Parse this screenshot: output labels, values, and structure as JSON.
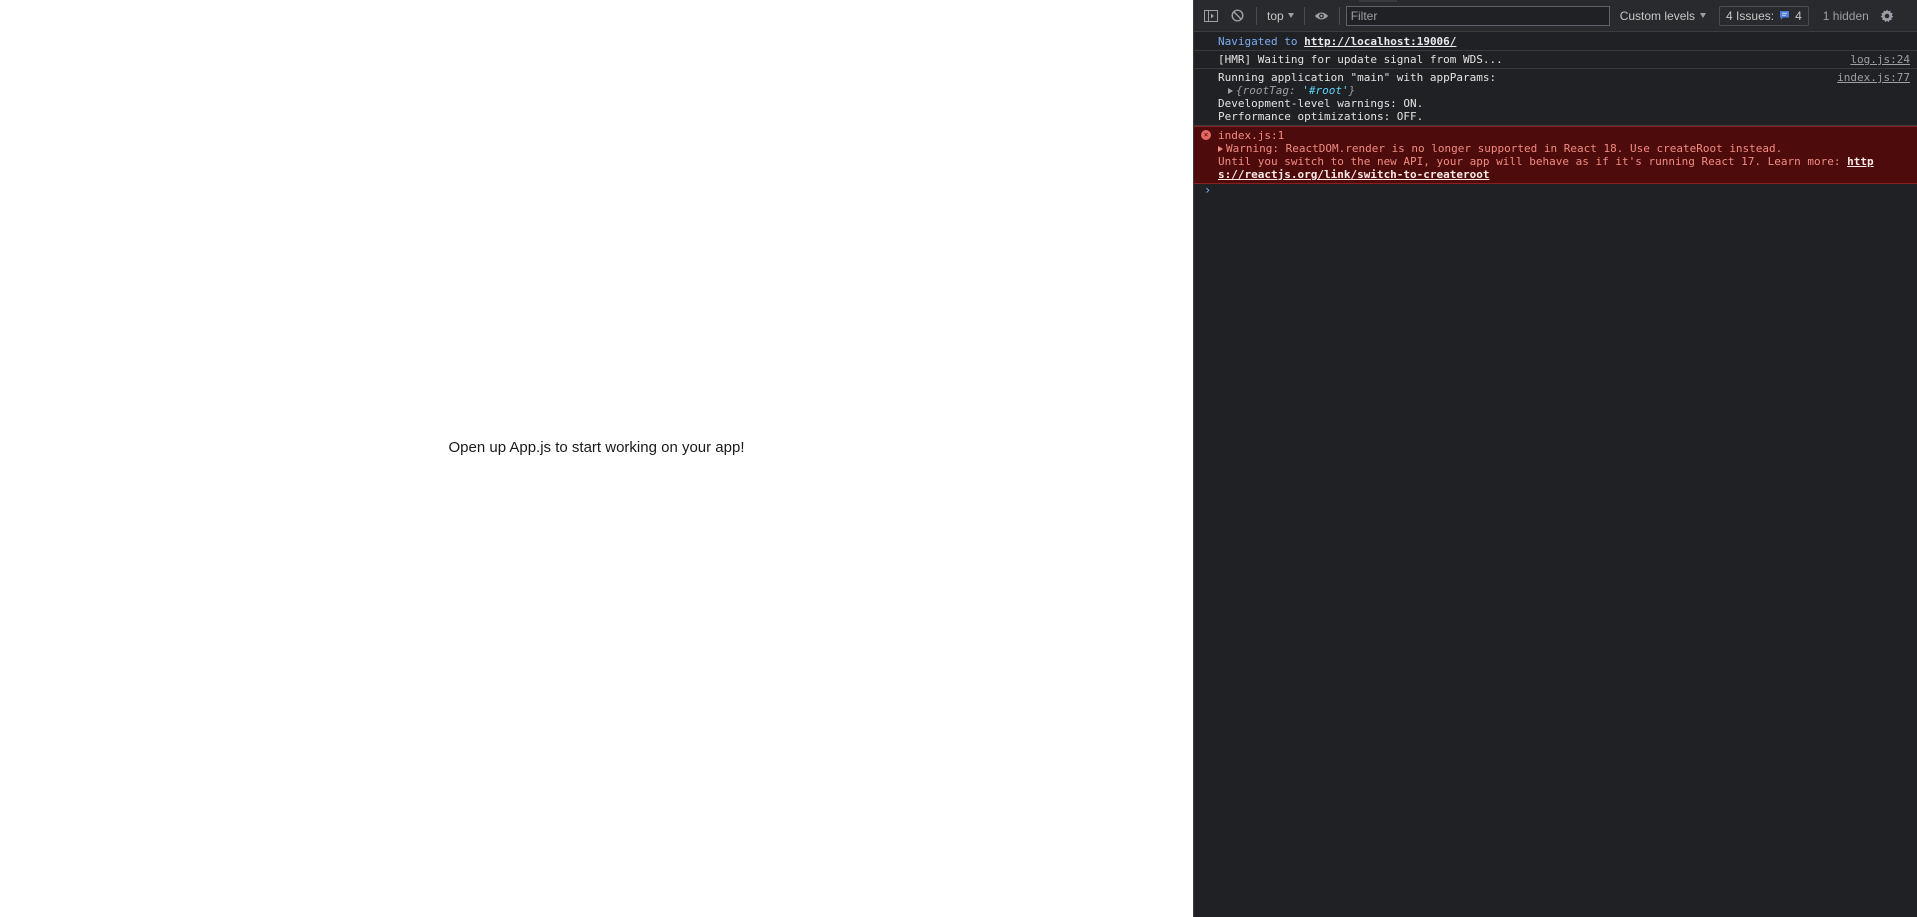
{
  "app": {
    "message": "Open up App.js to start working on your app!"
  },
  "toolbar": {
    "context": "top",
    "filter_placeholder": "Filter",
    "levels_label": "Custom levels",
    "issues_label": "4 Issues:",
    "issues_count": "4",
    "hidden_label": "1 hidden",
    "icons": [
      "sidebar-toggle-icon",
      "clear-console-icon",
      "eye-icon",
      "gear-icon"
    ]
  },
  "console": {
    "nav": {
      "prefix": "Navigated to",
      "url": "http://localhost:19006/"
    },
    "hmr": {
      "text": "[HMR] Waiting for update signal from WDS...",
      "source": "log.js:24"
    },
    "run": {
      "text": "Running application \"main\" with appParams:",
      "source": "index.js:77",
      "obj_open": "{",
      "obj_key": "rootTag",
      "obj_colon": ":",
      "obj_value": "'#root'",
      "obj_close": "}",
      "line2": "Development-level warnings: ON.",
      "line3": "Performance optimizations: OFF."
    },
    "warning": {
      "text": "Warning: ReactDOM.render is no longer supported in React 18. Use createRoot instead.",
      "text2": "Until you switch to the new API, your app will behave as if it's running React 17. Learn more:",
      "link_part1": "http",
      "link_part2": "s://reactjs.org/link/switch-to-createroot",
      "source": "index.js:1"
    },
    "prompt": "›"
  },
  "colors": {
    "devtools_bg": "#202124",
    "error_bg": "#4e0b0b",
    "error_text": "#f28b82",
    "link_blue": "#7cacf8"
  }
}
